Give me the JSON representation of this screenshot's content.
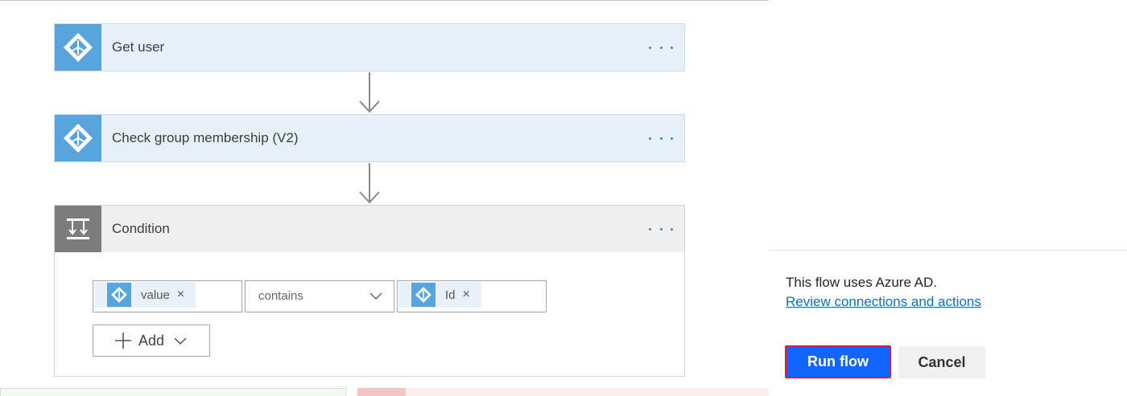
{
  "steps": [
    {
      "title": "Get user",
      "icon": "azure-ad-icon"
    },
    {
      "title": "Check group membership (V2)",
      "icon": "azure-ad-icon"
    }
  ],
  "condition": {
    "title": "Condition",
    "icon": "condition-icon",
    "left_token": "value",
    "operator": "contains",
    "right_token": "Id",
    "add_label": "Add"
  },
  "panel": {
    "info_text": "This flow uses Azure AD.",
    "link_text": "Review connections and actions",
    "run_label": "Run flow",
    "cancel_label": "Cancel"
  },
  "colors": {
    "accent": "#58a4dc",
    "run_button": "#1464ff",
    "run_outline": "#d91f2a",
    "link": "#106ebe"
  }
}
